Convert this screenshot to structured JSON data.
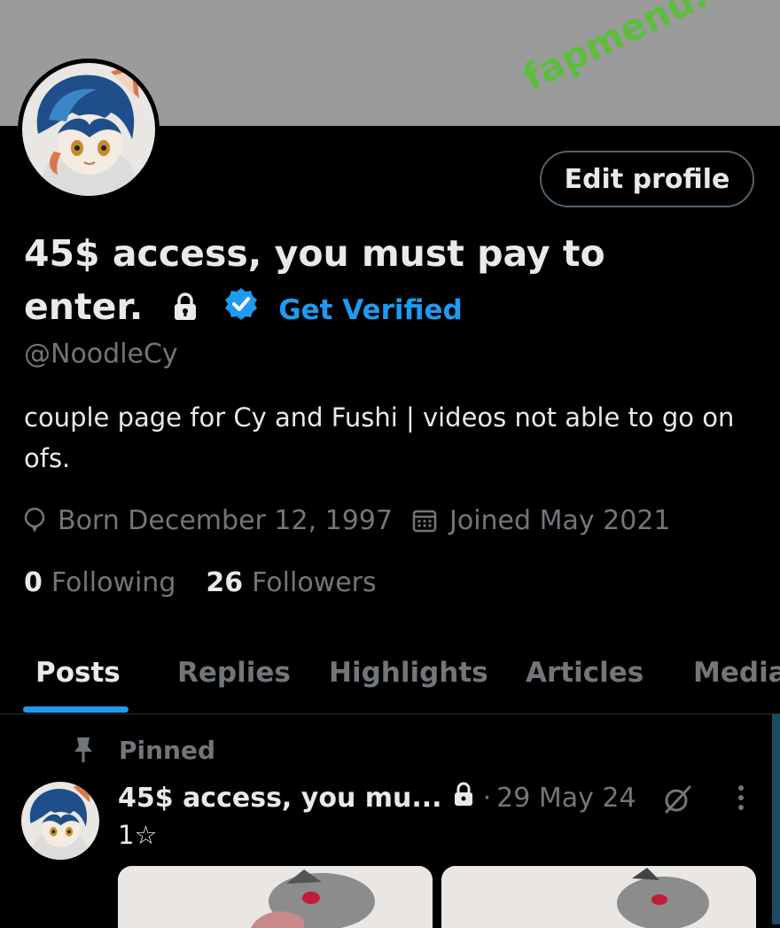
{
  "banner": {
    "color": "#9b9b9b"
  },
  "watermark": "fapmenu.com",
  "header": {
    "edit_profile_label": "Edit profile"
  },
  "profile": {
    "name_line1": "45$ access, you must pay to",
    "name_line2": "enter.",
    "get_verified_label": "Get Verified",
    "handle": "@NoodleCy",
    "bio": "couple page for Cy and Fushi | videos not able to go on ofs.",
    "born": "Born December 12, 1997",
    "joined": "Joined May 2021",
    "following_count": "0",
    "following_label": "Following",
    "followers_count": "26",
    "followers_label": "Followers"
  },
  "tabs": [
    {
      "label": "Posts",
      "active": true
    },
    {
      "label": "Replies",
      "active": false
    },
    {
      "label": "Highlights",
      "active": false
    },
    {
      "label": "Articles",
      "active": false
    },
    {
      "label": "Media",
      "active": false
    }
  ],
  "pinned_post": {
    "pinned_label": "Pinned",
    "author_name": "45$ access, you mu...",
    "separator": "·",
    "date": "29 May 24",
    "text": "1☆"
  },
  "icons": {
    "lock": "lock-icon",
    "verified": "verified-badge-icon",
    "born": "balloon-icon",
    "joined": "calendar-icon",
    "pin": "pin-icon",
    "grok": "grok-icon",
    "more": "more-vertical-icon"
  },
  "colors": {
    "accent": "#1d9bf0",
    "background": "#000000",
    "text_primary": "#e7e9ea",
    "text_secondary": "#71767b",
    "watermark": "#5bbf3b"
  }
}
